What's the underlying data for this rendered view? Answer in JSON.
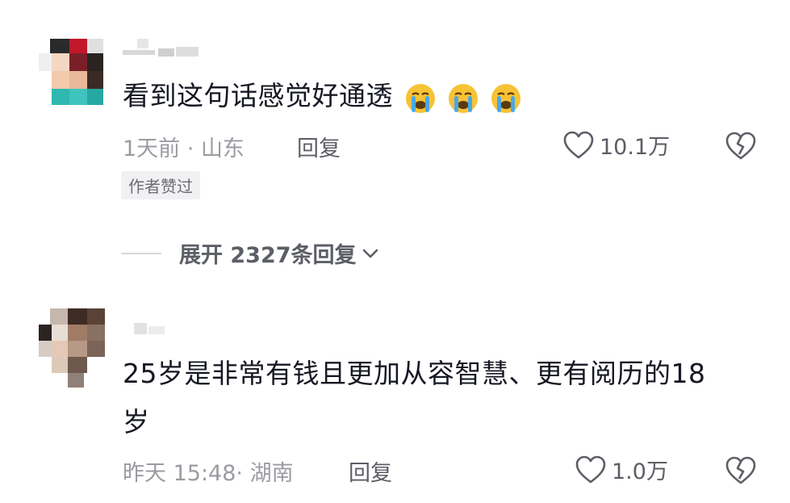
{
  "comments": [
    {
      "text": "看到这句话感觉好通透",
      "emojis": [
        "crying-face-emoji",
        "crying-face-emoji",
        "crying-face-emoji"
      ],
      "time": "1天前",
      "location": "山东",
      "reply_label": "回复",
      "likes": "10.1万",
      "badge": "作者赞过",
      "expand_label": "展开 2327条回复"
    },
    {
      "text_line1": "25岁是非常有钱且更加从容智慧、更有阅历的18",
      "text_line2": "岁",
      "time": "昨天 15:48",
      "location": "湖南",
      "reply_label": "回复",
      "likes": "1.0万"
    }
  ],
  "colors": {
    "text_primary": "#161823",
    "text_meta": "#9b9ca2",
    "text_secondary": "#5c5e66",
    "badge_bg": "#f1f1f3",
    "emoji_yellow": "#f7c234",
    "emoji_tear": "#4aa8e8"
  },
  "icons": {
    "like": "heart-outline-icon",
    "dislike": "broken-heart-icon",
    "expand": "chevron-down-icon"
  }
}
